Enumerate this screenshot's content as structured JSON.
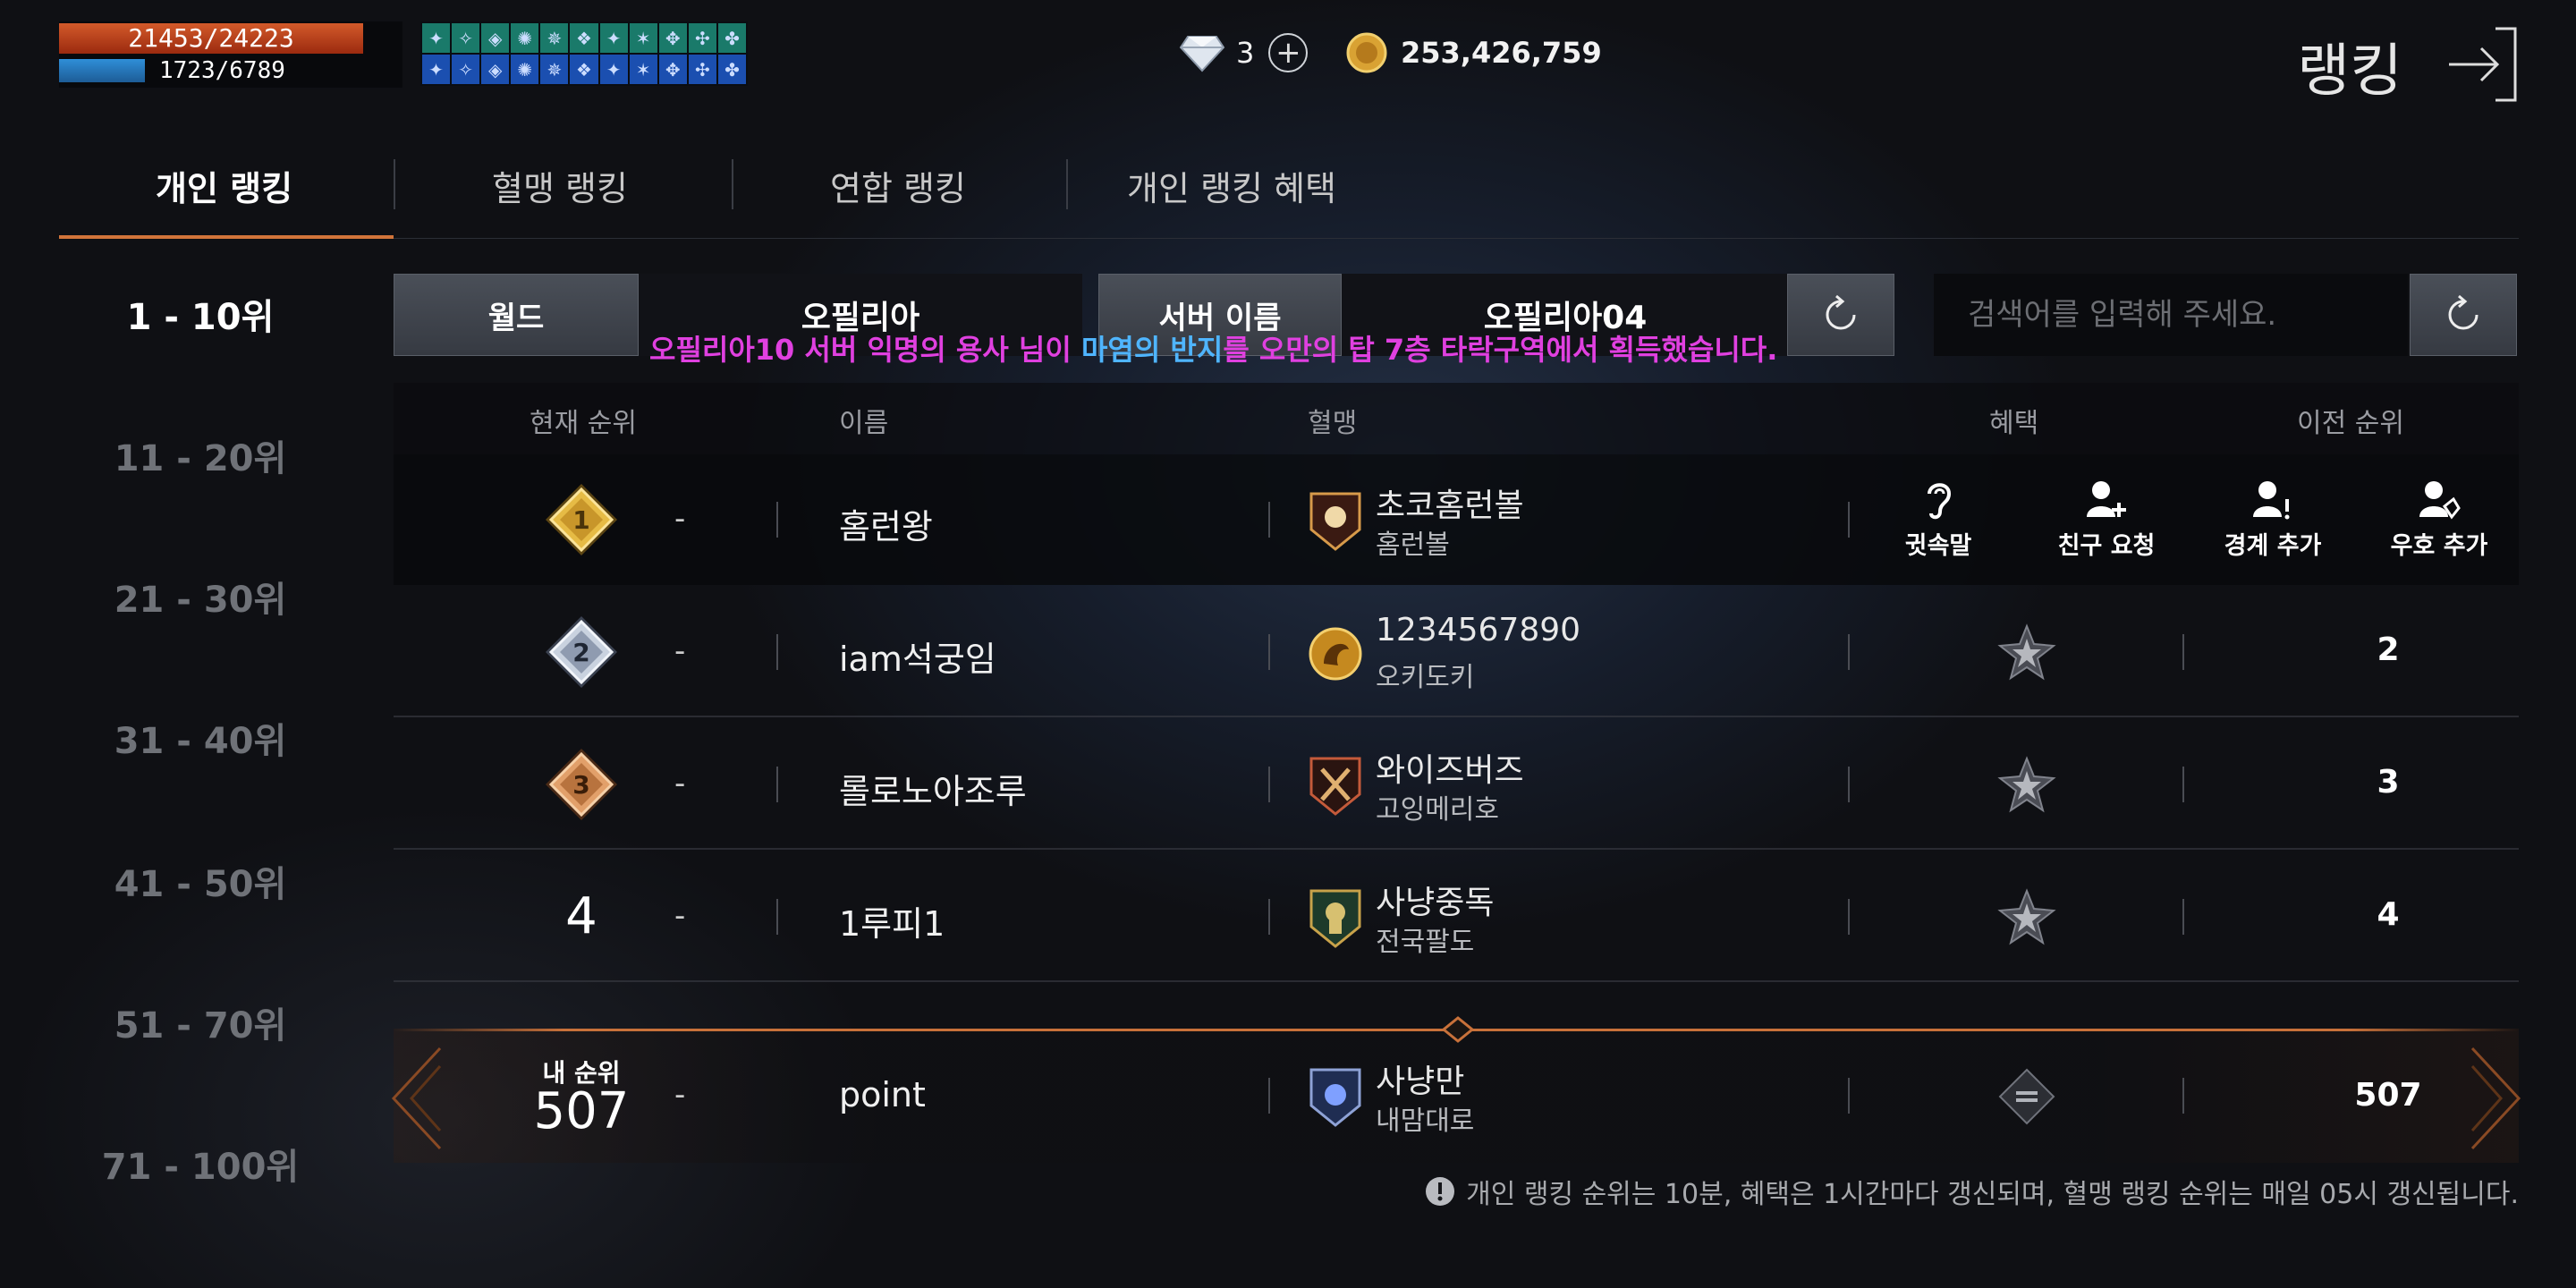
{
  "hud": {
    "hp": "21453/24223",
    "mp": "1723/6789",
    "buff_icons": [
      "buff-icon",
      "buff-icon",
      "buff-icon",
      "buff-icon",
      "buff-icon",
      "buff-icon",
      "buff-icon",
      "buff-icon",
      "buff-icon",
      "buff-icon",
      "buff-icon"
    ]
  },
  "currency": {
    "diamond": "3",
    "gold": "253,426,759"
  },
  "page_title": "랭킹",
  "tabs": [
    "개인 랭킹",
    "혈맹 랭킹",
    "연합 랭킹",
    "개인 랭킹 혜택"
  ],
  "ranges": [
    "1 - 10위",
    "11 - 20위",
    "21 - 30위",
    "31 - 40위",
    "41 - 50위",
    "51 - 70위",
    "71 - 100위"
  ],
  "filters": {
    "world_label": "월드",
    "world_value": "오필리아",
    "server_label": "서버 이름",
    "server_value": "오필리아04",
    "search_placeholder": "검색어를 입력해 주세요."
  },
  "notice": {
    "pre": "오필리아10 서버 익명의 용사 님이 ",
    "item": "마염의 반지",
    "post": "를 오만의 탑 7층 타락구역에서 획득했습니다."
  },
  "columns": {
    "rank": "현재 순위",
    "name": "이름",
    "clan": "혈맹",
    "benefit": "혜택",
    "prev": "이전 순위"
  },
  "actions": [
    "귓속말",
    "친구 요청",
    "경계 추가",
    "우호 추가"
  ],
  "rows": [
    {
      "rank": "1",
      "change": "-",
      "name": "홈런왕",
      "clan": "초코홈런볼",
      "clan_sub": "홈런볼",
      "prev": ""
    },
    {
      "rank": "2",
      "change": "-",
      "name": "iam석궁임",
      "clan": "1234567890",
      "clan_sub": "오키도키",
      "prev": "2"
    },
    {
      "rank": "3",
      "change": "-",
      "name": "롤로노아조루",
      "clan": "와이즈버즈",
      "clan_sub": "고잉메리호",
      "prev": "3"
    },
    {
      "rank": "4",
      "change": "-",
      "name": "1루피1",
      "clan": "사냥중독",
      "clan_sub": "전국팔도",
      "prev": "4"
    }
  ],
  "my_rank": {
    "label": "내 순위",
    "rank": "507",
    "change": "-",
    "name": "point",
    "clan": "사냥만",
    "clan_sub": "내맘대로",
    "prev": "507"
  },
  "footnote": "개인 랭킹 순위는 10분, 혜택은 1시간마다 갱신되며, 혈맹 랭킹 순위는 매일 05시 갱신됩니다.",
  "colors": {
    "accent": "#d1743a",
    "notice": "#e040e0",
    "notice_item": "#4fb5ff",
    "hp": "#c84a1e",
    "mp": "#2f8fd8"
  }
}
